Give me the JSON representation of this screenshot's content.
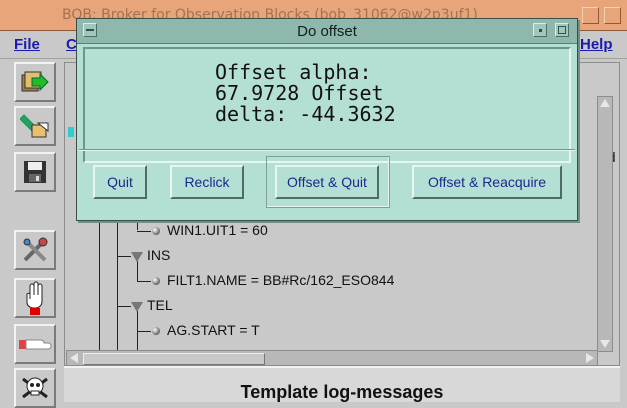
{
  "window": {
    "title": "BOB: Broker for Observation Blocks (bob_31062@w2p3uf1)"
  },
  "menubar": {
    "file": "File",
    "obscured_item": "C",
    "help": "Help"
  },
  "toolbar": {
    "icons": [
      "load-ob-icon",
      "edit-ob-icon",
      "save-icon",
      "tools-icon",
      "stop-hand-icon",
      "pause-hand-icon",
      "abort-skull-icon"
    ]
  },
  "tree": {
    "partial_right_text": "ad",
    "nodes": [
      {
        "label": "WIN1.UIT1 = 60"
      },
      {
        "label": "INS"
      },
      {
        "label": "FILT1.NAME = BB#Rc/162_ESO844"
      },
      {
        "label": "TEL"
      },
      {
        "label": "AG.START = T"
      }
    ]
  },
  "log": {
    "header": "Template log-messages"
  },
  "dialog": {
    "title": "Do offset",
    "message": "Offset alpha:\n67.9728 Offset\ndelta: -44.3632",
    "buttons": {
      "quit": "Quit",
      "reclick": "Reclick",
      "offset_quit": "Offset & Quit",
      "offset_reacquire": "Offset & Reacquire"
    }
  }
}
